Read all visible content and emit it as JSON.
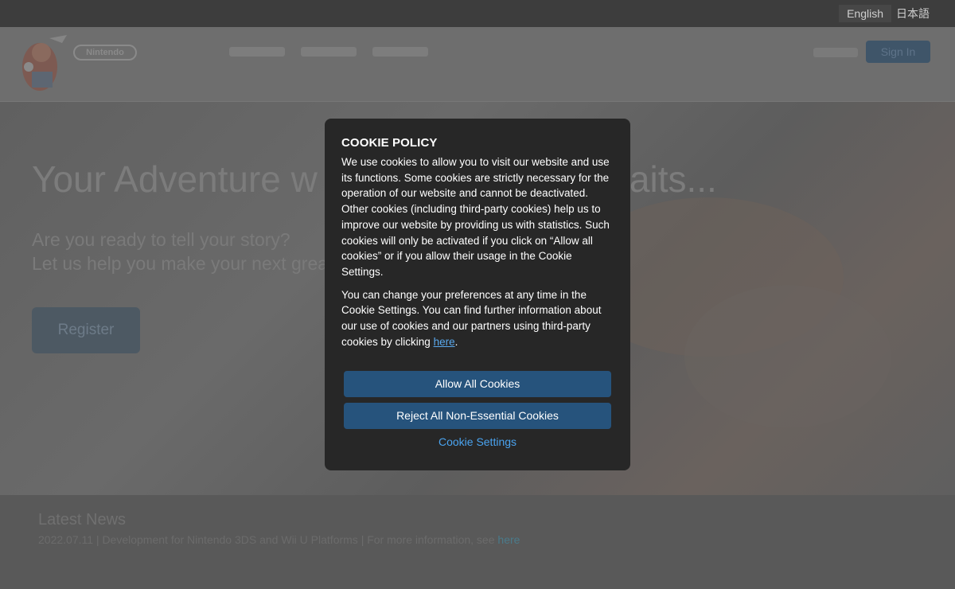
{
  "topbar": {
    "languages": [
      "English",
      "日本語"
    ]
  },
  "header": {
    "brand": "Nintendo",
    "sign_in": "Sign In"
  },
  "hero": {
    "title": "Your Adventure w",
    "title_end": "aits...",
    "subtitle_1": "Are you ready to tell your story?",
    "subtitle_2": "Let us help you make your next great",
    "register": "Register"
  },
  "news": {
    "title": "Latest News",
    "item": "2022.07.11 | Development for Nintendo 3DS and Wii U Platforms | For more information, see",
    "item_link": "here"
  },
  "cookie_modal": {
    "title": "COOKIE POLICY",
    "paragraph_1": "We use cookies to allow you to visit our website and use its functions. Some cookies are strictly necessary for the operation of our website and cannot be deactivated. Other cookies (including third-party cookies) help us to improve our website by providing us with statistics. Such cookies will only be activated if you click on “Allow all cookies” or if you allow their usage in the Cookie Settings.",
    "paragraph_2": "You can change your preferences at any time in the Cookie Settings. You can find further information about our use of cookies and our partners using third-party cookies by clicking",
    "paragraph_2_link": "here",
    "paragraph_2_end": ".",
    "allow_all": "Allow All Cookies",
    "reject_all": "Reject All Non-Essential Cookies",
    "settings": "Cookie Settings"
  },
  "colors": {
    "modal_bg": "#272727",
    "primary_button": "#26537c",
    "link": "#4aa3ef",
    "overlay_page": "#5a5a5a"
  }
}
